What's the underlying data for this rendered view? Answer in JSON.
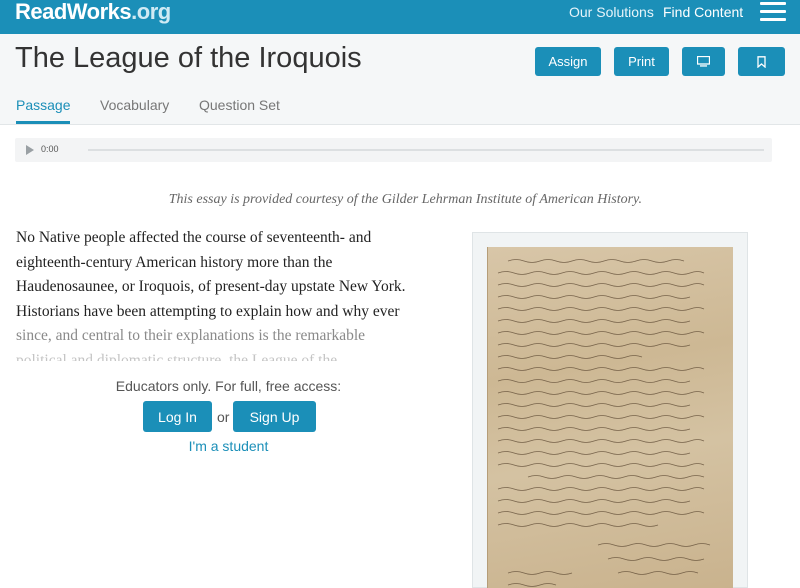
{
  "nav": {
    "logo_main": "ReadWorks",
    "logo_suffix": ".org",
    "links": [
      "Our Solutions",
      "Find Content"
    ]
  },
  "header": {
    "title": "The League of the Iroquois",
    "buttons": {
      "assign": "Assign",
      "print": "Print"
    },
    "tabs": [
      "Passage",
      "Vocabulary",
      "Question Set"
    ]
  },
  "audio": {
    "time": "0:00"
  },
  "passage": {
    "courtesy": "This essay is provided courtesy of the Gilder Lehrman Institute of American History.",
    "lines": [
      "No Native people affected the course of seventeenth- and",
      "eighteenth-century American history more than the",
      "Haudenosaunee, or Iroquois, of present-day upstate New York.",
      "Historians have been attempting to explain how and why ever",
      "since, and central to their explanations is the remarkable",
      "political and diplomatic structure, the League of the..."
    ]
  },
  "access": {
    "prompt": "Educators only. For full, free access:",
    "login": "Log In",
    "or": "or",
    "signup": "Sign Up",
    "student": "I'm a student"
  },
  "colors": {
    "brand": "#1b8fb8",
    "title_band": "#f5f7f8"
  },
  "icons": {
    "menu": "hamburger-icon",
    "present": "monitor-icon",
    "bookmark": "bookmark-icon",
    "play": "play-icon"
  }
}
